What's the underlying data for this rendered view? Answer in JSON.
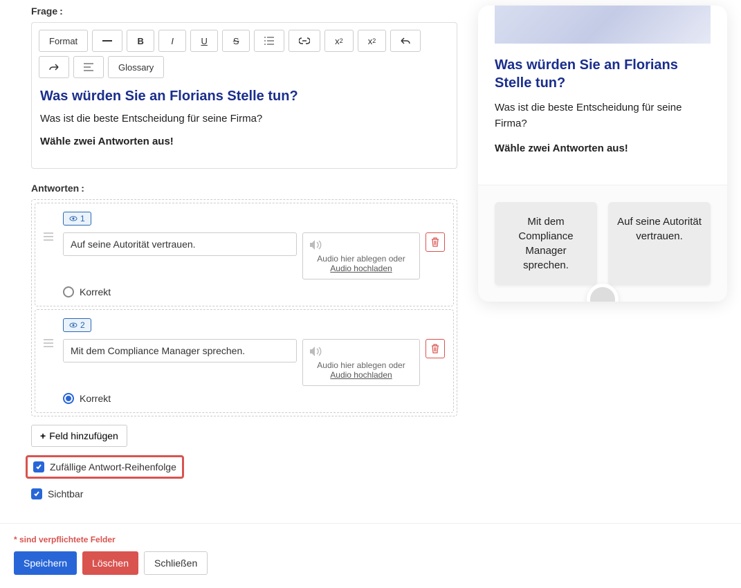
{
  "labels": {
    "question": "Frage",
    "answers": "Antworten",
    "colon": ":"
  },
  "toolbar": {
    "format": "Format",
    "glossary": "Glossary"
  },
  "editor": {
    "title": "Was würden Sie an Florians Stelle tun?",
    "subtitle": "Was ist die beste Entscheidung für seine Firma?",
    "instruction": "Wähle zwei Antworten aus!"
  },
  "answers": [
    {
      "tag": "1",
      "text": "Auf seine Autorität vertrauen.",
      "correct": false,
      "correctLabel": "Korrekt"
    },
    {
      "tag": "2",
      "text": "Mit dem Compliance Manager sprechen.",
      "correct": true,
      "correctLabel": "Korrekt"
    }
  ],
  "audio": {
    "dropText": "Audio hier ablegen oder",
    "uploadLink": "Audio hochladen"
  },
  "addField": "Feld hinzufügen",
  "options": {
    "randomOrder": "Zufällige Antwort-Reihenfolge",
    "visible": "Sichtbar"
  },
  "footer": {
    "required": "* sind verpflichtete Felder",
    "save": "Speichern",
    "delete": "Löschen",
    "close": "Schließen"
  },
  "preview": {
    "title": "Was würden Sie an Florians Stelle tun?",
    "subtitle": "Was ist die beste Entscheidung für seine Firma?",
    "instruction": "Wähle zwei Antworten aus!",
    "answers": [
      "Mit dem Compliance Manager sprechen.",
      "Auf seine Autorität vertrauen."
    ]
  }
}
